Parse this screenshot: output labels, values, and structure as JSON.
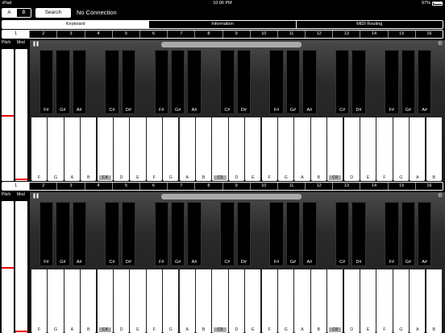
{
  "status": {
    "device": "iPad",
    "time": "10:06 PM",
    "battery": "97%"
  },
  "toolbar": {
    "tab_a": "A",
    "tab_b": "B",
    "search_label": "Search",
    "connection_status": "No Connection"
  },
  "main_tabs": [
    "Keyboard",
    "Information",
    "MIDI Routing"
  ],
  "channels": [
    "1",
    "2",
    "3",
    "4",
    "5",
    "6",
    "7",
    "8",
    "9",
    "10",
    "11",
    "12",
    "13",
    "14",
    "15",
    "16"
  ],
  "controls": {
    "pitch_label": "Pitch",
    "mod_label": "Mod"
  },
  "white_key_labels": [
    "F",
    "G",
    "A",
    "B",
    "C4",
    "D",
    "E",
    "F",
    "G",
    "A",
    "B",
    "C5",
    "D",
    "E",
    "F",
    "G",
    "A",
    "B",
    "C6",
    "D",
    "E",
    "F",
    "G",
    "A",
    "B"
  ],
  "black_key_labels": [
    "F#",
    "G#",
    "A#",
    "C#",
    "D#",
    "F#",
    "G#",
    "A#",
    "C#",
    "D#",
    "F#",
    "G#",
    "A#",
    "C#",
    "D#",
    "F#",
    "G#",
    "A#"
  ],
  "colors": {
    "accent_red": "#e00000",
    "background": "#000000"
  },
  "icons": {
    "pause": "pause-icon",
    "settings": "gear-icon"
  }
}
